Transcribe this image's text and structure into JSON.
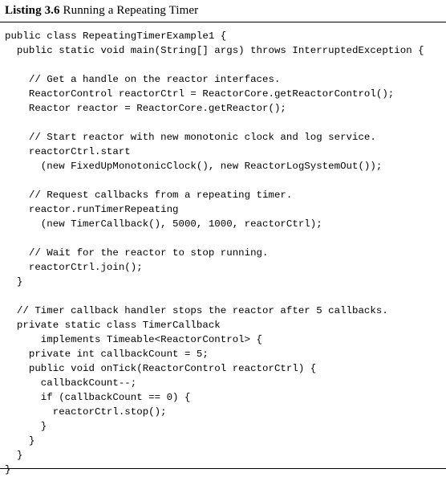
{
  "listing": {
    "caption_label": "Listing 3.6",
    "caption_text": "Running a Repeating Timer",
    "language": "Java",
    "code_lines": [
      "public class RepeatingTimerExample1 {",
      "  public static void main(String[] args) throws InterruptedException {",
      "",
      "    // Get a handle on the reactor interfaces.",
      "    ReactorControl reactorCtrl = ReactorCore.getReactorControl();",
      "    Reactor reactor = ReactorCore.getReactor();",
      "",
      "    // Start reactor with new monotonic clock and log service.",
      "    reactorCtrl.start",
      "      (new FixedUpMonotonicClock(), new ReactorLogSystemOut());",
      "",
      "    // Request callbacks from a repeating timer.",
      "    reactor.runTimerRepeating",
      "      (new TimerCallback(), 5000, 1000, reactorCtrl);",
      "",
      "    // Wait for the reactor to stop running.",
      "    reactorCtrl.join();",
      "  }",
      "",
      "  // Timer callback handler stops the reactor after 5 callbacks.",
      "  private static class TimerCallback",
      "      implements Timeable<ReactorControl> {",
      "    private int callbackCount = 5;",
      "    public void onTick(ReactorControl reactorCtrl) {",
      "      callbackCount--;",
      "      if (callbackCount == 0) {",
      "        reactorCtrl.stop();",
      "      }",
      "    }",
      "  }",
      "}"
    ]
  },
  "colors": {
    "text": "#000000",
    "background": "#ffffff",
    "rule": "#000000"
  }
}
